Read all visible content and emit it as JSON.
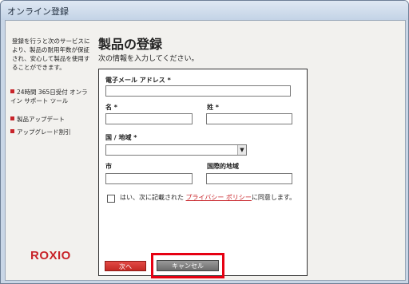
{
  "window": {
    "title": "オンライン登録"
  },
  "sidebar": {
    "description": "登録を行うと次のサービスにより、製品の耐用年数が保証され、安心して製品を使用することができます。",
    "items": [
      {
        "label": "24時間 365日受付 オンライン サポート ツール"
      },
      {
        "label": "製品アップデート"
      },
      {
        "label": "アップグレード割引"
      }
    ],
    "logo": "ROXIO"
  },
  "main": {
    "title": "製品の登録",
    "subtitle": "次の情報を入力してください。"
  },
  "form": {
    "email_label": "電子メール アドレス *",
    "first_name_label": "名 *",
    "last_name_label": "姓 *",
    "country_label": "国 / 地域 *",
    "city_label": "市",
    "intl_area_label": "国際的地域",
    "consent_prefix": "はい、次に記載された",
    "privacy_link": "プライバシー ポリシー",
    "consent_suffix": "に同意します。",
    "email_value": "",
    "first_name_value": "",
    "last_name_value": "",
    "country_value": "",
    "city_value": "",
    "intl_area_value": ""
  },
  "buttons": {
    "next": "次へ",
    "cancel": "キャンセル"
  },
  "colors": {
    "accent": "#c8242a",
    "highlight_frame": "#e60012"
  }
}
